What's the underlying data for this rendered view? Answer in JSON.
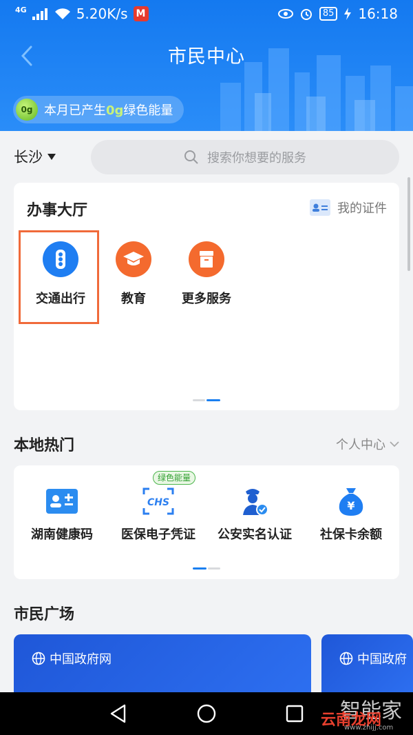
{
  "status": {
    "network": "4G",
    "speed": "5.20K/s",
    "metro_badge": "M",
    "battery": "85",
    "time": "16:18"
  },
  "header": {
    "title": "市民中心",
    "energy_prefix": "本月已产生",
    "energy_value": "0g",
    "energy_suffix": "绿色能量",
    "energy_ball": "0g"
  },
  "city": "长沙",
  "search": {
    "placeholder": "搜索你想要的服务"
  },
  "hall": {
    "title": "办事大厅",
    "my_cert": "我的证件",
    "services": [
      {
        "label": "交通出行",
        "icon": "traffic-light-icon",
        "color": "#1f7ef2"
      },
      {
        "label": "教育",
        "icon": "graduation-cap-icon",
        "color": "#f46a2e"
      },
      {
        "label": "更多服务",
        "icon": "box-icon",
        "color": "#f46a2e"
      }
    ]
  },
  "hot": {
    "title": "本地热门",
    "personal": "个人中心",
    "badge": "绿色能量",
    "items": [
      {
        "label": "湖南健康码",
        "icon": "id-card-icon"
      },
      {
        "label": "医保电子凭证",
        "icon": "chs-icon"
      },
      {
        "label": "公安实名认证",
        "icon": "police-icon"
      },
      {
        "label": "社保卡余额",
        "icon": "money-bag-icon"
      }
    ]
  },
  "square": {
    "title": "市民广场",
    "banners": [
      "中国政府网",
      "中国政府"
    ]
  },
  "watermark": {
    "cn": "智能家",
    "site": "云南龙网",
    "url": "www.zhijj.com"
  }
}
